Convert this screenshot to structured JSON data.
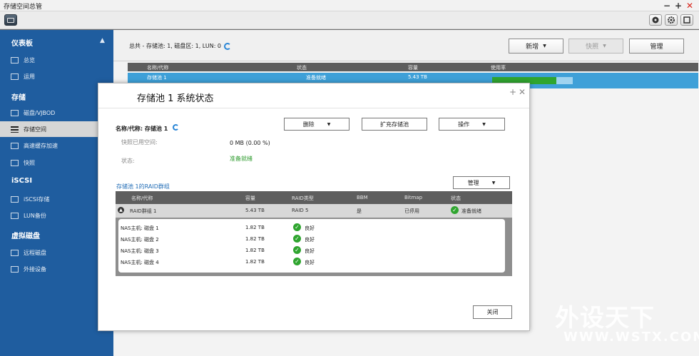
{
  "app": {
    "title": "存储空间总管"
  },
  "window_controls": {
    "minimize": "−",
    "maximize": "+",
    "close": "✕"
  },
  "sidebar": {
    "sections": [
      {
        "label": "仪表板",
        "collapse_icon": "chevron-up-icon"
      },
      {
        "label": "存储"
      },
      {
        "label": "iSCSI"
      },
      {
        "label": "虚拟磁盘"
      }
    ],
    "items": [
      {
        "label": "总览",
        "icon": "dashboard-icon"
      },
      {
        "label": "运用",
        "icon": "chart-icon"
      },
      {
        "label": "磁盘/VJBOD",
        "icon": "disk-icon"
      },
      {
        "label": "存储空间",
        "icon": "list-icon",
        "active": true
      },
      {
        "label": "高速缓存加速",
        "icon": "cache-icon"
      },
      {
        "label": "快照",
        "icon": "snapshot-icon"
      },
      {
        "label": "iSCSI存储",
        "icon": "iscsi-icon"
      },
      {
        "label": "LUN备份",
        "icon": "backup-icon"
      },
      {
        "label": "远程磁盘",
        "icon": "remote-disk-icon"
      },
      {
        "label": "外接设备",
        "icon": "external-device-icon"
      }
    ]
  },
  "main": {
    "summary": "总共 - 存储池: 1, 磁盘区: 1, LUN: 0",
    "buttons": {
      "new": "新增",
      "snapshot": "快照",
      "manage": "管理"
    },
    "columns": [
      "名称/代称",
      "状态",
      "容量",
      "使用率"
    ],
    "rows": [
      {
        "name": "存储池 1",
        "status": "准备就绪",
        "capacity": "5.43 TB",
        "usage_fraction": 0.8
      }
    ]
  },
  "modal": {
    "title": "存储池 1 系统状态",
    "name_label": "名称/代称: 存储池 1",
    "buttons": {
      "delete": "删除",
      "expand": "扩充存储池",
      "actions": "操作",
      "manage": "管理",
      "close": "关闭"
    },
    "snapshot_space_label": "快照已用空间:",
    "snapshot_space_value": "0 MB (0.00 %)",
    "status_label": "状态:",
    "status_value": "准备就绪",
    "raid_title": "存储池 1的RAID群组",
    "raid_columns": [
      "名称/代称",
      "容量",
      "RAID类型",
      "BBM",
      "Bitmap",
      "状态"
    ],
    "raid_group": {
      "name": "RAID群组 1",
      "capacity": "5.43 TB",
      "raid": "RAID 5",
      "bbm": "是",
      "bitmap": "已停用",
      "status": "准备就绪"
    },
    "disks": [
      {
        "name": "NAS主机: 磁盘 1",
        "capacity": "1.82 TB",
        "status": "良好"
      },
      {
        "name": "NAS主机: 磁盘 2",
        "capacity": "1.82 TB",
        "status": "良好"
      },
      {
        "name": "NAS主机: 磁盘 3",
        "capacity": "1.82 TB",
        "status": "良好"
      },
      {
        "name": "NAS主机: 磁盘 4",
        "capacity": "1.82 TB",
        "status": "良好"
      }
    ]
  },
  "watermark": {
    "line1": "外设天下",
    "line2": "WWW.WSTX.COM"
  }
}
